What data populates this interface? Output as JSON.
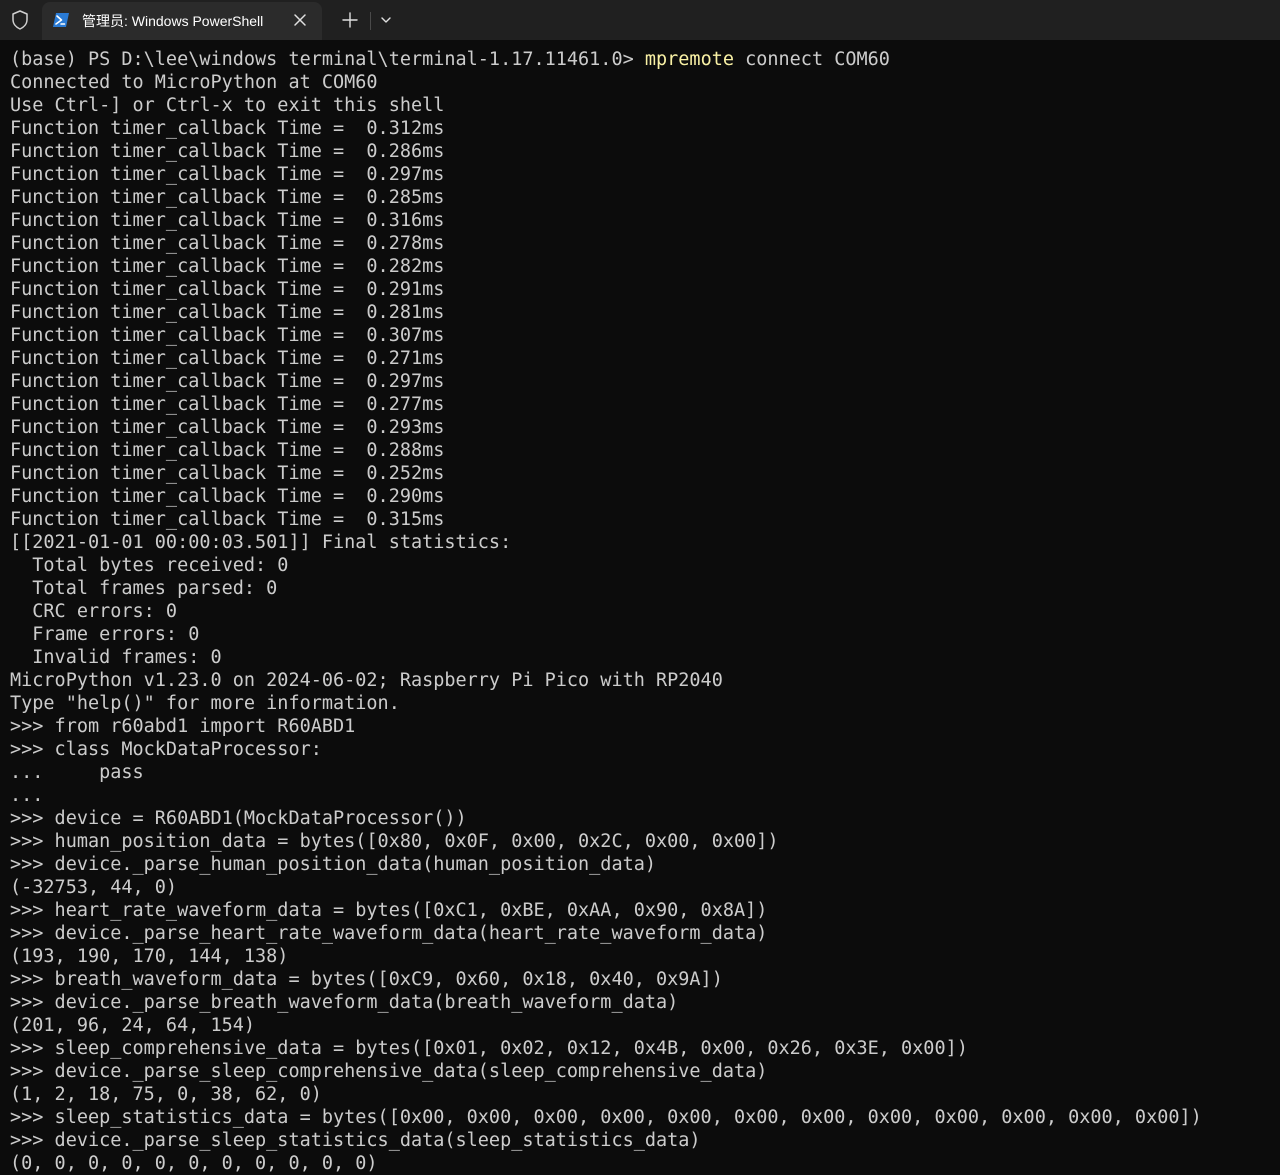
{
  "window": {
    "tab_title": "管理员: Windows PowerShell",
    "icons": {
      "shield": "shield-icon",
      "tab": "powershell-icon",
      "close": "close-icon",
      "new_tab": "plus-icon",
      "dropdown": "chevron-down-icon"
    }
  },
  "colors": {
    "background": "#0c0c0c",
    "tabbar": "#202020",
    "active_tab": "#2b2b2b",
    "text": "#cccccc",
    "command_highlight": "#f9f1a5",
    "powershell_icon": "#2a7bd5"
  },
  "terminal": {
    "prompt_line": {
      "prompt": "(base) PS D:\\lee\\windows terminal\\terminal-1.17.11461.0> ",
      "command": "mpremote",
      "args": " connect COM60"
    },
    "lines": [
      "Connected to MicroPython at COM60",
      "Use Ctrl-] or Ctrl-x to exit this shell",
      "Function timer_callback Time =  0.312ms",
      "Function timer_callback Time =  0.286ms",
      "Function timer_callback Time =  0.297ms",
      "Function timer_callback Time =  0.285ms",
      "Function timer_callback Time =  0.316ms",
      "Function timer_callback Time =  0.278ms",
      "Function timer_callback Time =  0.282ms",
      "Function timer_callback Time =  0.291ms",
      "Function timer_callback Time =  0.281ms",
      "Function timer_callback Time =  0.307ms",
      "Function timer_callback Time =  0.271ms",
      "Function timer_callback Time =  0.297ms",
      "Function timer_callback Time =  0.277ms",
      "Function timer_callback Time =  0.293ms",
      "Function timer_callback Time =  0.288ms",
      "Function timer_callback Time =  0.252ms",
      "Function timer_callback Time =  0.290ms",
      "Function timer_callback Time =  0.315ms",
      "[[2021-01-01 00:00:03.501]] Final statistics:",
      "  Total bytes received: 0",
      "  Total frames parsed: 0",
      "  CRC errors: 0",
      "  Frame errors: 0",
      "  Invalid frames: 0",
      "MicroPython v1.23.0 on 2024-06-02; Raspberry Pi Pico with RP2040",
      "Type \"help()\" for more information.",
      ">>> from r60abd1 import R60ABD1",
      ">>> class MockDataProcessor:",
      "...     pass",
      "...",
      ">>> device = R60ABD1(MockDataProcessor())",
      ">>> human_position_data = bytes([0x80, 0x0F, 0x00, 0x2C, 0x00, 0x00])",
      ">>> device._parse_human_position_data(human_position_data)",
      "(-32753, 44, 0)",
      ">>> heart_rate_waveform_data = bytes([0xC1, 0xBE, 0xAA, 0x90, 0x8A])",
      ">>> device._parse_heart_rate_waveform_data(heart_rate_waveform_data)",
      "(193, 190, 170, 144, 138)",
      ">>> breath_waveform_data = bytes([0xC9, 0x60, 0x18, 0x40, 0x9A])",
      ">>> device._parse_breath_waveform_data(breath_waveform_data)",
      "(201, 96, 24, 64, 154)",
      ">>> sleep_comprehensive_data = bytes([0x01, 0x02, 0x12, 0x4B, 0x00, 0x26, 0x3E, 0x00])",
      ">>> device._parse_sleep_comprehensive_data(sleep_comprehensive_data)",
      "(1, 2, 18, 75, 0, 38, 62, 0)",
      ">>> sleep_statistics_data = bytes([0x00, 0x00, 0x00, 0x00, 0x00, 0x00, 0x00, 0x00, 0x00, 0x00, 0x00, 0x00])",
      ">>> device._parse_sleep_statistics_data(sleep_statistics_data)",
      "(0, 0, 0, 0, 0, 0, 0, 0, 0, 0, 0)"
    ]
  }
}
